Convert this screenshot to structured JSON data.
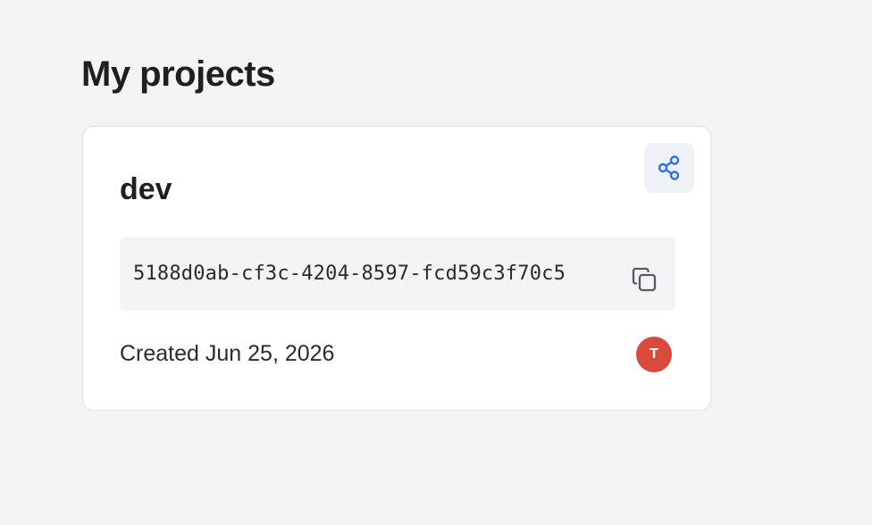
{
  "page": {
    "title": "My projects"
  },
  "project": {
    "name": "dev",
    "id": "5188d0ab-cf3c-4204-8597-fcd59c3f70c5",
    "created": "Created Jun 25, 2026",
    "owner_initial": "T",
    "avatar_color": "#d9493c",
    "share_icon": "share-icon",
    "copy_icon": "copy-icon"
  }
}
